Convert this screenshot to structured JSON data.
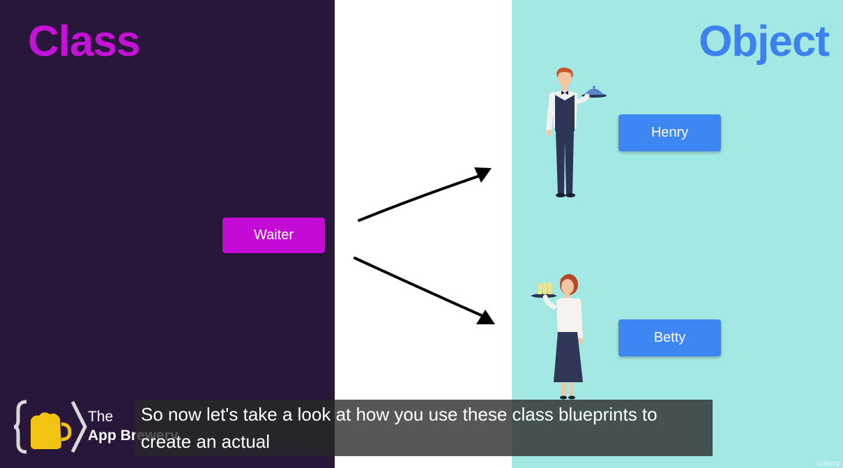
{
  "slide": {
    "class_title": "Class",
    "object_title": "Object",
    "class_box_label": "Waiter",
    "objects": [
      {
        "label": "Henry"
      },
      {
        "label": "Betty"
      }
    ]
  },
  "logo": {
    "line1": "The",
    "line2": "App Brewery"
  },
  "caption": {
    "text": "So now let's take a look at how you use these class blueprints to create an actual"
  },
  "watermark": "udemy",
  "colors": {
    "left_panel": "#28173b",
    "right_panel": "#a3e8e2",
    "class_accent": "#c511d8",
    "object_accent": "#3f86f5"
  },
  "icons": [
    "waiter-male-illustration",
    "waitress-female-illustration",
    "app-brewery-logo-icon",
    "arrow-icon"
  ]
}
